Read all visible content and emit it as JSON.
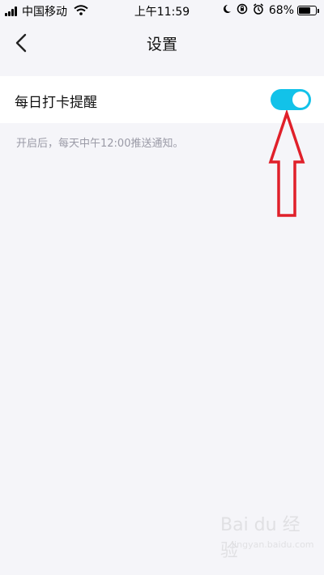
{
  "status_bar": {
    "carrier": "中国移动",
    "time": "上午11:59",
    "battery_percent": "68%",
    "battery_level": 0.68,
    "icons": [
      "signal-icon",
      "wifi-icon",
      "moon-icon",
      "orientation-lock-icon",
      "alarm-icon",
      "battery-icon"
    ]
  },
  "nav": {
    "title": "设置",
    "back_icon": "chevron-left-icon"
  },
  "settings": {
    "daily_reminder_label": "每日打卡提醒",
    "daily_reminder_enabled": true,
    "hint": "开启后，每天中午12:00推送通知。"
  },
  "colors": {
    "toggle_on": "#12c2e9",
    "annotation_arrow": "#e0202a",
    "background": "#f5f5f9"
  },
  "watermark": {
    "logo": "Bai du 经验",
    "sub": "jingyan.baidu.com"
  }
}
